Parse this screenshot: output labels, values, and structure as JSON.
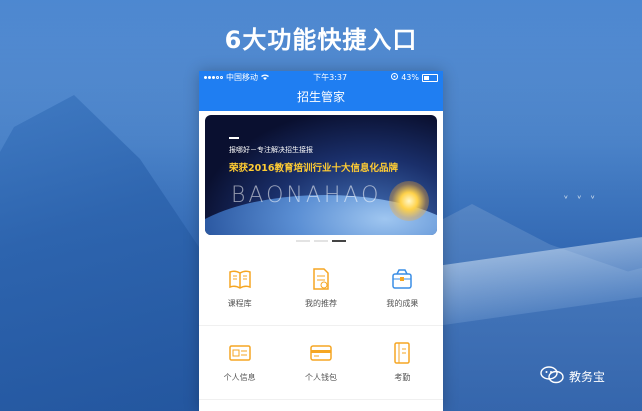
{
  "headline": "6大功能快捷入口",
  "status_bar": {
    "carrier": "中国移动",
    "time": "下午3:37",
    "battery": "43%"
  },
  "nav": {
    "title": "招生管家"
  },
  "banner": {
    "subtitle": "报哪好－专注解决招生接报",
    "title": "荣获2016教育培训行业十大信息化品牌",
    "brand": "BAONAHAO"
  },
  "features": [
    {
      "label": "课程库",
      "icon": "book-icon"
    },
    {
      "label": "我的推荐",
      "icon": "document-icon"
    },
    {
      "label": "我的成果",
      "icon": "trophy-bag-icon"
    },
    {
      "label": "个人信息",
      "icon": "id-card-icon"
    },
    {
      "label": "个人钱包",
      "icon": "wallet-icon"
    },
    {
      "label": "考勤",
      "icon": "attendance-book-icon"
    }
  ],
  "watermark": {
    "text": "教务宝"
  },
  "colors": {
    "primary": "#1f7ef2",
    "icon_orange": "#f5a623",
    "icon_blue": "#3a8ee6"
  }
}
